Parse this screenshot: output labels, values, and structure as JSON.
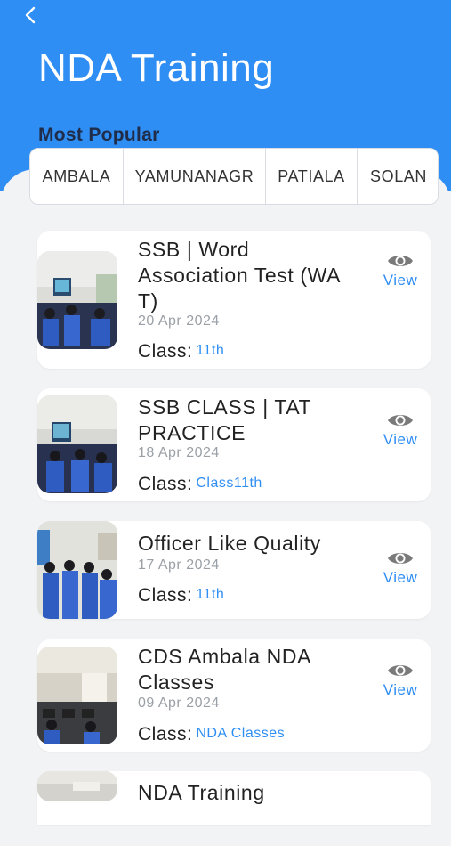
{
  "header": {
    "title": "NDA Training",
    "section_label": "Most Popular"
  },
  "tabs": [
    {
      "label": "AMBALA"
    },
    {
      "label": "YAMUNANAGR"
    },
    {
      "label": "PATIALA"
    },
    {
      "label": "SOLAN"
    }
  ],
  "view_label": "View",
  "class_prefix": "Class:",
  "items": [
    {
      "title": "SSB | Word Association Test (WA T)",
      "date": "20 Apr 2024",
      "class": "11th"
    },
    {
      "title": "SSB CLASS | TAT PRACTICE",
      "date": "18 Apr 2024",
      "class": "Class11th"
    },
    {
      "title": " Officer Like Quality",
      "date": "17 Apr 2024",
      "class": "11th"
    },
    {
      "title": "CDS Ambala NDA Classes",
      "date": "09 Apr 2024",
      "class": "NDA Classes"
    },
    {
      "title": "NDA Training"
    }
  ],
  "colors": {
    "accent": "#2f8ef3",
    "background": "#f2f3f5"
  },
  "icons": {
    "back": "chevron-left-icon",
    "view": "eye-icon"
  }
}
